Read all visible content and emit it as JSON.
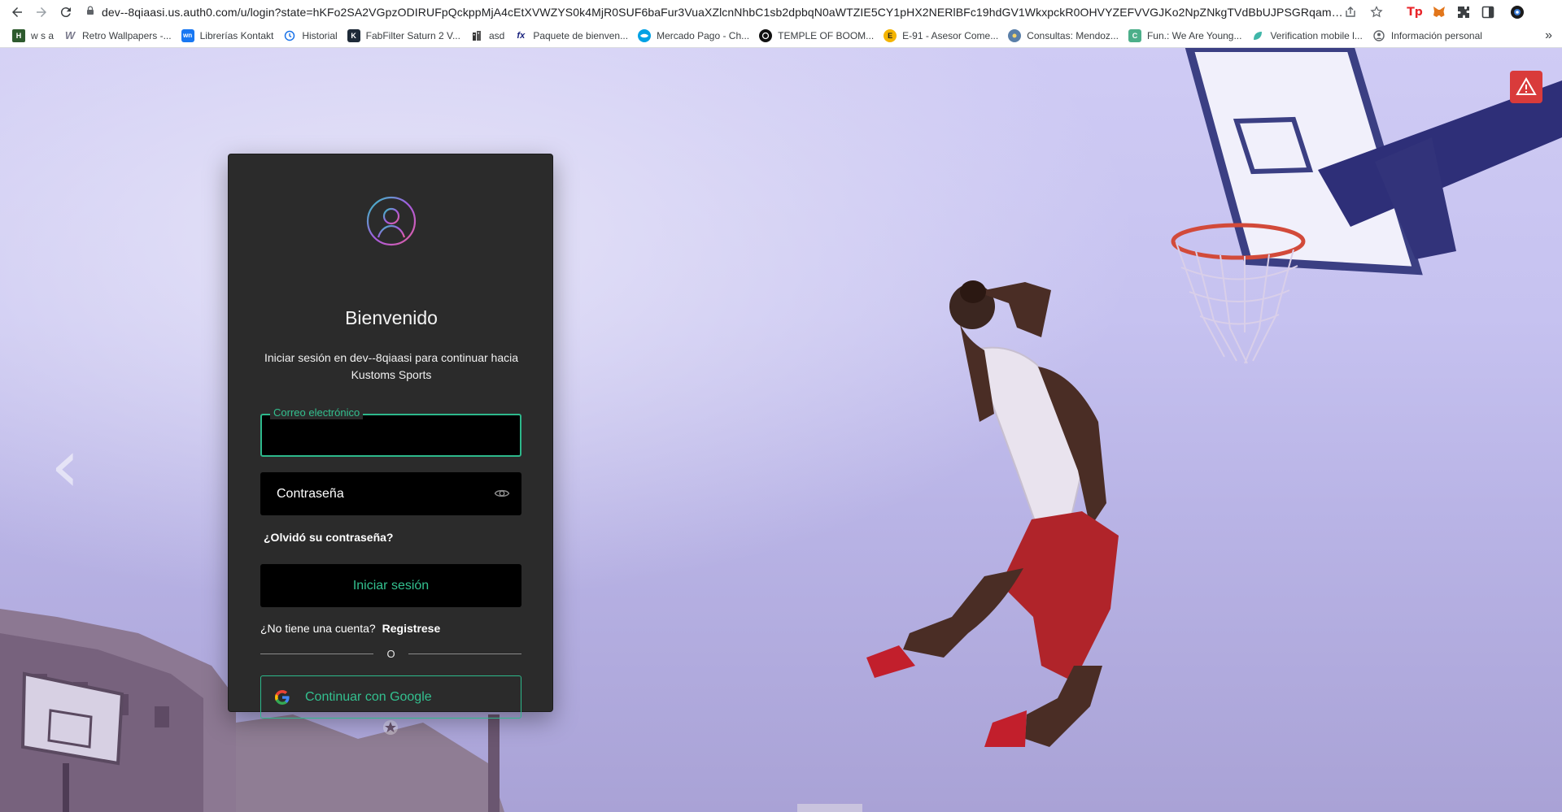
{
  "browser": {
    "url": "dev--8qiaasi.us.auth0.com/u/login?state=hKFo2SA2VGpzODIRUFpQckppMjA4cEtXVWZYS0k4MjR0SUF6baFur3VuaXZlcnNhbC1sb2dpbqN0aWTZIE5CY1pHX2NERlBFc19hdGV1WkxpckR0OHVYZEFVVGJKo2NpZNkgTVdBbUJPSGRqamFaWnYwb2F...",
    "bookmarks": [
      {
        "label": "w s a",
        "icon": "h-favicon-icon",
        "color": "#2e5a2e"
      },
      {
        "label": "Retro Wallpapers -...",
        "icon": "w-favicon-icon",
        "color": "#7a7a8c"
      },
      {
        "label": "Librerías Kontakt",
        "icon": "wn-favicon-icon",
        "color": "#1877f2"
      },
      {
        "label": "Historial",
        "icon": "history-icon",
        "color": "#1a73e8"
      },
      {
        "label": "FabFilter Saturn 2 V...",
        "icon": "k-favicon-icon",
        "color": "#1e2a38"
      },
      {
        "label": "asd",
        "icon": "building-favicon-icon",
        "color": "#333333"
      },
      {
        "label": "Paquete de bienven...",
        "icon": "fx-favicon-icon",
        "color": "#1a237e"
      },
      {
        "label": "Mercado Pago - Ch...",
        "icon": "handshake-favicon-icon",
        "color": "#00a1e4"
      },
      {
        "label": "TEMPLE OF BOOM...",
        "icon": "circle-favicon-icon",
        "color": "#111111"
      },
      {
        "label": "E-91 - Asesor Come...",
        "icon": "e-favicon-icon",
        "color": "#f4b400"
      },
      {
        "label": "Consultas: Mendoz...",
        "icon": "seal-favicon-icon",
        "color": "#5a7fa8"
      },
      {
        "label": "Fun.: We Are Young...",
        "icon": "c-favicon-icon",
        "color": "#4caf8a"
      },
      {
        "label": "Verification mobile l...",
        "icon": "leaf-favicon-icon",
        "color": "#3fb6a8"
      },
      {
        "label": "Información personal",
        "icon": "google-account-icon",
        "color": "#5f6368"
      }
    ],
    "more_bookmarks": "»"
  },
  "card": {
    "title": "Bienvenido",
    "subtitle": "Iniciar sesión en dev--8qiaasi para continuar hacia Kustoms Sports",
    "email_label": "Correo electrónico",
    "email_value": "",
    "password_placeholder": "Contraseña",
    "forgot_link": "¿Olvidó su contraseña?",
    "login_button": "Iniciar sesión",
    "signup_prompt": "¿No tiene una cuenta?",
    "signup_link": "Registrese",
    "divider_text": "O",
    "google_button": "Continuar con Google"
  },
  "colors": {
    "accent": "#33c08f",
    "card_bg": "#2b2b2b",
    "warning": "#d93b3b"
  }
}
